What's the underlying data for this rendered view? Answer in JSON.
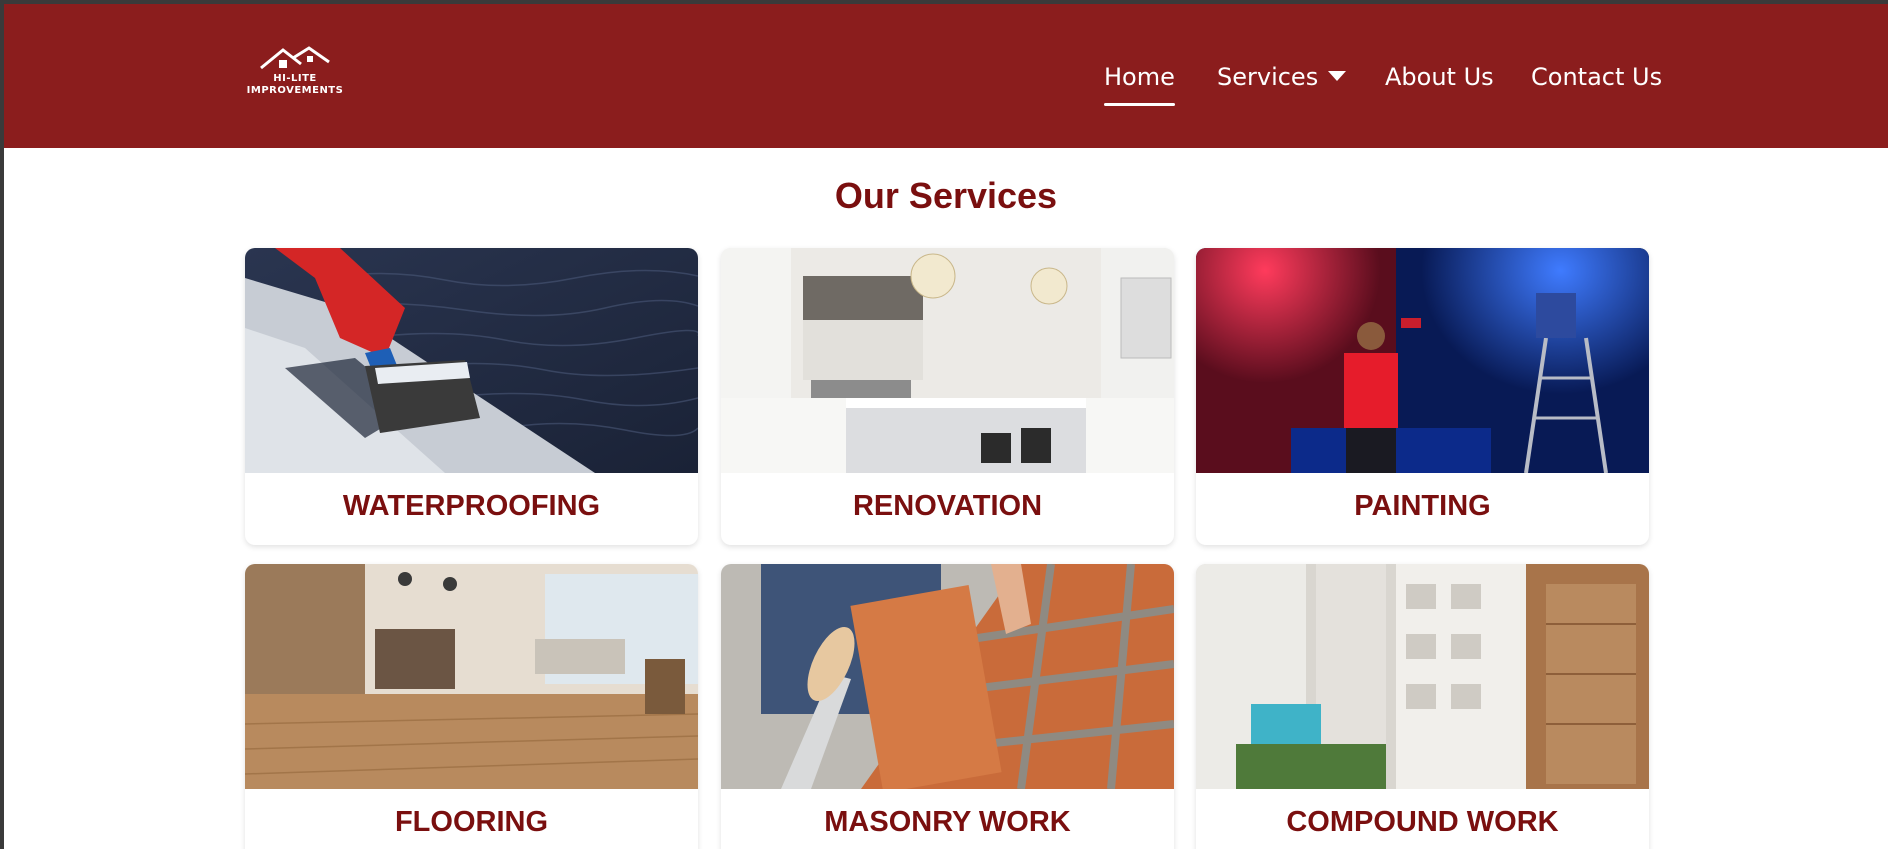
{
  "brand": {
    "line1": "HI-LITE",
    "line2": "IMPROVEMENTS"
  },
  "nav": {
    "home": "Home",
    "services": "Services",
    "about": "About Us",
    "contact": "Contact Us"
  },
  "section_title": "Our Services",
  "services": [
    {
      "label": "WATERPROOFING"
    },
    {
      "label": "RENOVATION"
    },
    {
      "label": "PAINTING"
    },
    {
      "label": "FLOORING"
    },
    {
      "label": "MASONRY WORK"
    },
    {
      "label": "COMPOUND WORK"
    }
  ],
  "colors": {
    "header": "#8b1d1d",
    "accent_text": "#7a0f0f"
  }
}
